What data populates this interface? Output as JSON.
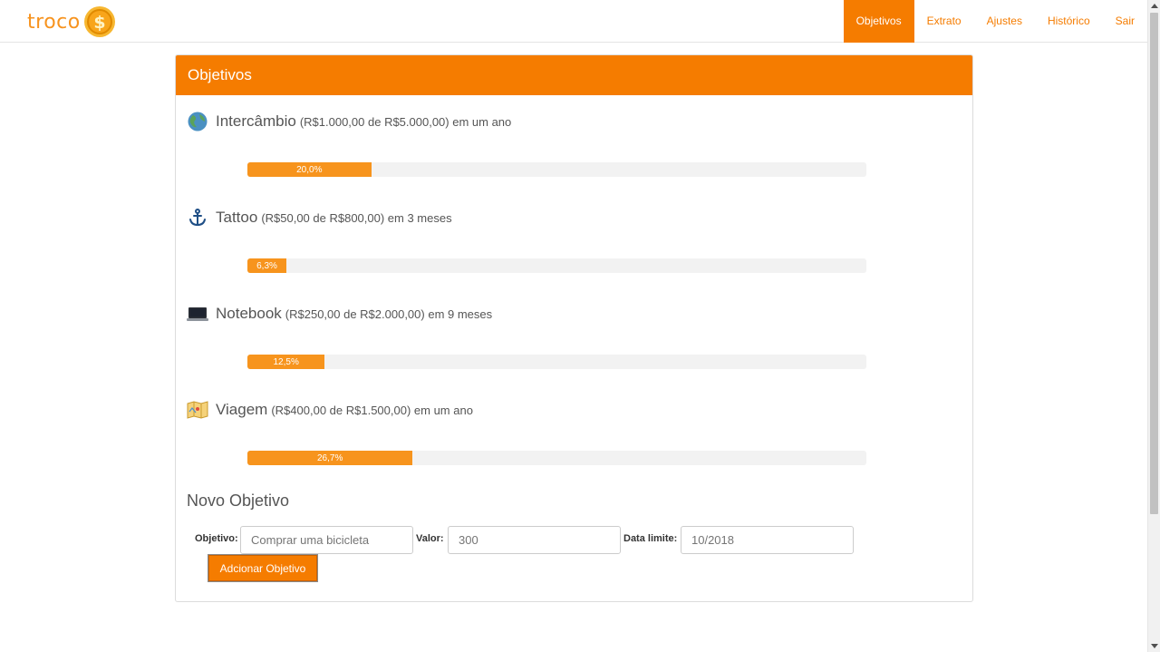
{
  "brand": {
    "name": "troco",
    "coin_symbol": "$"
  },
  "nav": {
    "items": [
      {
        "label": "Objetivos",
        "active": true
      },
      {
        "label": "Extrato"
      },
      {
        "label": "Ajustes"
      },
      {
        "label": "Histórico"
      },
      {
        "label": "Sair"
      }
    ]
  },
  "panel": {
    "title": "Objetivos"
  },
  "goals": [
    {
      "icon": "globe-icon",
      "name": "Intercâmbio",
      "detail": "(R$1.000,00 de R$5.000,00) em um ano",
      "progress_label": "20,0%",
      "progress": 20.0
    },
    {
      "icon": "anchor-icon",
      "name": "Tattoo",
      "detail": "(R$50,00 de R$800,00) em 3 meses",
      "progress_label": "6,3%",
      "progress": 6.3
    },
    {
      "icon": "laptop-icon",
      "name": "Notebook",
      "detail": "(R$250,00 de R$2.000,00) em 9 meses",
      "progress_label": "12,5%",
      "progress": 12.5
    },
    {
      "icon": "map-icon",
      "name": "Viagem",
      "detail": "(R$400,00 de R$1.500,00) em um ano",
      "progress_label": "26,7%",
      "progress": 26.7
    }
  ],
  "new_goal": {
    "title": "Novo Objetivo",
    "objetivo_label": "Objetivo:",
    "objetivo_placeholder": "Comprar uma bicicleta",
    "valor_label": "Valor:",
    "valor_placeholder": "300",
    "data_label": "Data limite:",
    "data_placeholder": "10/2018",
    "submit_label": "Adcionar Objetivo"
  },
  "colors": {
    "accent": "#f57c00",
    "progress": "#f7941d",
    "track": "#f2f2f2"
  }
}
